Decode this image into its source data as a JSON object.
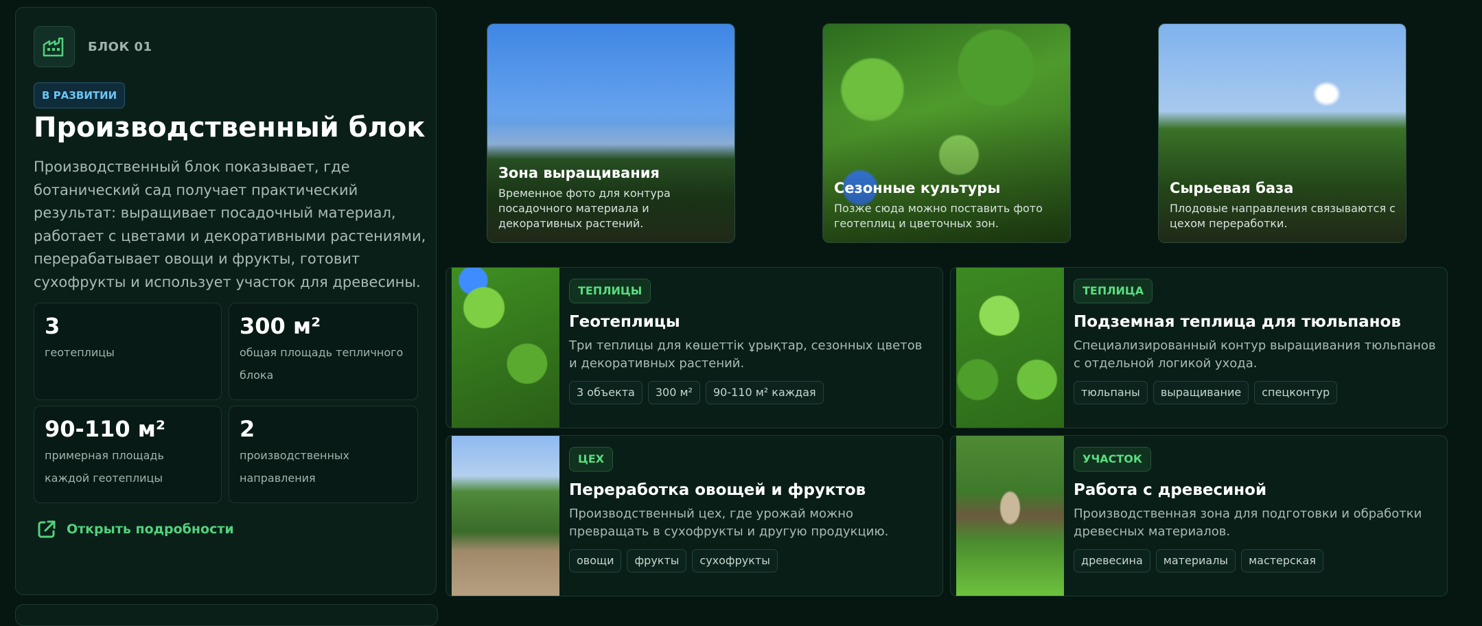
{
  "block": {
    "label": "БЛОК 01",
    "status": "В РАЗВИТИИ",
    "title": "Производственный блок",
    "description": "Производственный блок показывает, где ботанический сад получает практический результат: выращивает посадочный материал, работает с цветами и декоративными растениями, перерабатывает овощи и фрукты, готовит сухофрукты и использует участок для древесины.",
    "stats": [
      {
        "value": "3",
        "label": "геотеплицы"
      },
      {
        "value": "300 м²",
        "label": "общая площадь тепличного блока"
      },
      {
        "value": "90-110 м²",
        "label": "примерная площадь каждой геотеплицы"
      },
      {
        "value": "2",
        "label": "производственных направления"
      }
    ],
    "link": "Открыть подробности"
  },
  "photos": [
    {
      "title": "Зона выращивания",
      "text": "Временное фото для контура посадочного материала и декоративных растений."
    },
    {
      "title": "Сезонные культуры",
      "text": "Позже сюда можно поставить фото геотеплиц и цветочных зон."
    },
    {
      "title": "Сырьевая база",
      "text": "Плодовые направления связываются с цехом переработки."
    }
  ],
  "cards": [
    {
      "tag": "ТЕПЛИЦЫ",
      "title": "Геотеплицы",
      "text": "Три теплицы для көшеттік ұрықтар, сезонных цветов и декоративных растений.",
      "chips": [
        "3 объекта",
        "300 м²",
        "90-110 м² каждая"
      ]
    },
    {
      "tag": "ТЕПЛИЦА",
      "title": "Подземная теплица для тюльпанов",
      "text": "Специализированный контур выращивания тюльпанов с отдельной логикой ухода.",
      "chips": [
        "тюльпаны",
        "выращивание",
        "спецконтур"
      ]
    },
    {
      "tag": "ЦЕХ",
      "title": "Переработка овощей и фруктов",
      "text": "Производственный цех, где урожай можно превращать в сухофрукты и другую продукцию.",
      "chips": [
        "овощи",
        "фрукты",
        "сухофрукты"
      ]
    },
    {
      "tag": "УЧАСТОК",
      "title": "Работа с древесиной",
      "text": "Производственная зона для подготовки и обработки древесных материалов.",
      "chips": [
        "древесина",
        "материалы",
        "мастерская"
      ]
    }
  ],
  "icons": {
    "block": "factory-icon",
    "link": "external-link-icon"
  },
  "colors": {
    "accent": "#52d27c",
    "status": "#6cc4f5",
    "background": "#061611"
  }
}
